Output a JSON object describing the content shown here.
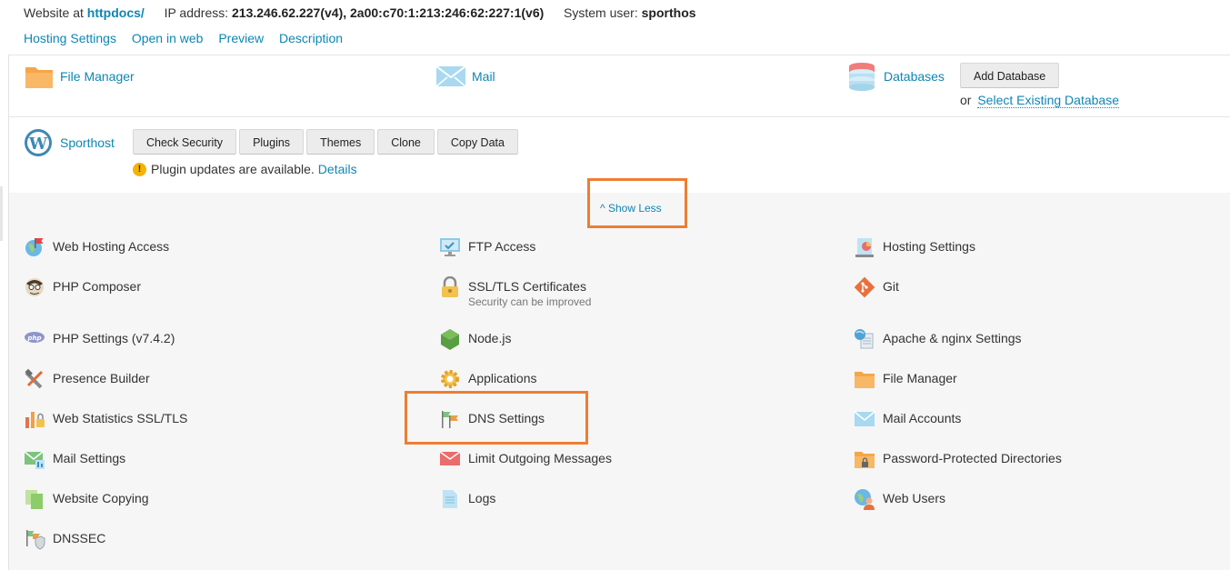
{
  "info": {
    "website_label": "Website at",
    "website_value": "httpdocs/",
    "ip_label": "IP address:",
    "ip_value": "213.246.62.227(v4), 2a00:c70:1:213:246:62:227:1(v6)",
    "user_label": "System user:",
    "user_value": "sporthos"
  },
  "links": [
    "Hosting Settings",
    "Open in web",
    "Preview",
    "Description"
  ],
  "tools": {
    "file_manager": "File Manager",
    "mail": "Mail",
    "databases": "Databases",
    "add_database": "Add Database",
    "or_text": "or",
    "select_db": "Select Existing Database"
  },
  "wordpress": {
    "name": "Sporthost",
    "buttons": [
      "Check Security",
      "Plugins",
      "Themes",
      "Clone",
      "Copy Data"
    ],
    "notice": "Plugin updates are available.",
    "details": "Details"
  },
  "show_less": "Show Less",
  "highlight_color": "#ee7d33",
  "link_color": "#0e86b4",
  "col1": [
    {
      "label": "Web Hosting Access",
      "icon": "globe-flag-icon"
    },
    {
      "label": "PHP Composer",
      "icon": "composer-icon"
    },
    {
      "label": "PHP Settings (v7.4.2)",
      "icon": "php-icon"
    },
    {
      "label": "Presence Builder",
      "icon": "tools-icon"
    },
    {
      "label": "Web Statistics SSL/TLS",
      "icon": "stats-lock-icon"
    },
    {
      "label": "Mail Settings",
      "icon": "mail-settings-icon"
    },
    {
      "label": "Website Copying",
      "icon": "copy-icon"
    },
    {
      "label": "DNSSEC",
      "icon": "dnssec-shield-icon"
    }
  ],
  "col2": [
    {
      "label": "FTP Access",
      "icon": "ftp-monitor-icon"
    },
    {
      "label": "SSL/TLS Certificates",
      "sub": "Security can be improved",
      "icon": "padlock-icon"
    },
    {
      "label": "Node.js",
      "icon": "nodejs-icon"
    },
    {
      "label": "Applications",
      "icon": "gear-icon"
    },
    {
      "label": "DNS Settings",
      "icon": "dns-flags-icon"
    },
    {
      "label": "Limit Outgoing Messages",
      "icon": "limit-mail-icon"
    },
    {
      "label": "Logs",
      "icon": "log-doc-icon"
    }
  ],
  "col3": [
    {
      "label": "Hosting Settings",
      "icon": "hosting-settings-icon"
    },
    {
      "label": "Git",
      "icon": "git-icon"
    },
    {
      "label": "Apache & nginx Settings",
      "icon": "apache-nginx-icon"
    },
    {
      "label": "File Manager",
      "icon": "folder-icon"
    },
    {
      "label": "Mail Accounts",
      "icon": "envelope-icon"
    },
    {
      "label": "Password-Protected Directories",
      "icon": "locked-folder-icon"
    },
    {
      "label": "Web Users",
      "icon": "web-users-icon"
    }
  ]
}
